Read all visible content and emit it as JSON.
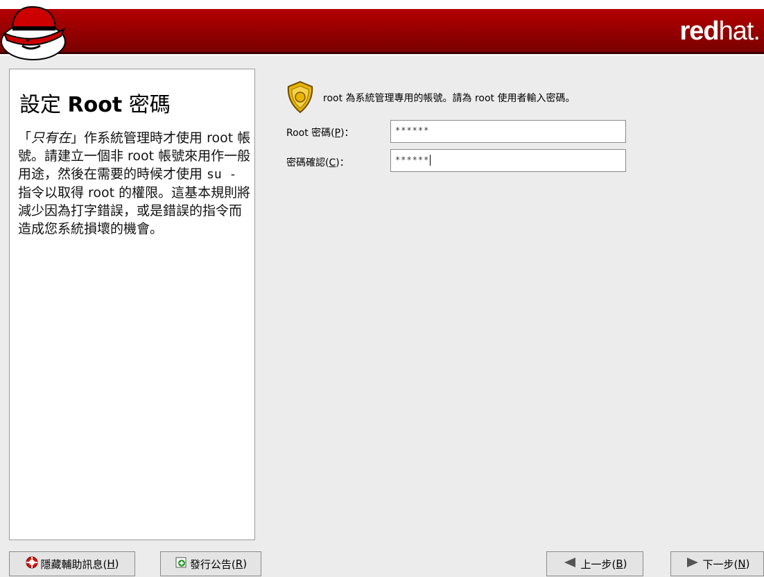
{
  "header": {
    "brand_bold": "red",
    "brand_light": "hat."
  },
  "help": {
    "title_pre": "設定",
    "title_bold": "Root",
    "title_post": "密碼",
    "p1_open": "「",
    "p1_italic": "只有在",
    "p1_rest": "」作系統管理時才使用 root 帳號。請建立一個非 root 帳號來用作一般用途，然後在需要的時候才使用 ",
    "p1_cmd": "su -",
    "p1_end": " 指令以取得 root 的權限。這基本規則將減少因為打字錯誤，或是錯誤的指令而造成您系統損壞的機會。"
  },
  "main": {
    "intro": "root 為系統管理專用的帳號。請為 root 使用者輸入密碼。",
    "password_label_pre": "Root 密碼(",
    "password_label_key": "P",
    "password_label_post": ")：",
    "password_value": "******",
    "confirm_label_pre": "密碼確認(",
    "confirm_label_key": "C",
    "confirm_label_post": ")：",
    "confirm_value": "******"
  },
  "buttons": {
    "hide_help_pre": "隱藏輔助訊息(",
    "hide_help_key": "H",
    "hide_help_post": ")",
    "release_notes_pre": "發行公告(",
    "release_notes_key": "R",
    "release_notes_post": ")",
    "back_pre": "上一步(",
    "back_key": "B",
    "back_post": ")",
    "next_pre": "下一步(",
    "next_key": "N",
    "next_post": ")"
  },
  "colors": {
    "header_red": "#a00000",
    "badge_gold": "#e8b400"
  },
  "icons": {
    "hat": "redhat-logo",
    "badge": "security-badge-icon",
    "hide_help": "lifebuoy-icon",
    "release_notes": "notes-icon",
    "back": "arrow-left-icon",
    "next": "arrow-right-icon"
  }
}
